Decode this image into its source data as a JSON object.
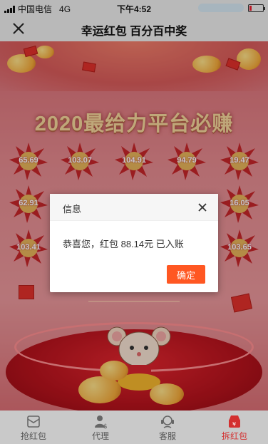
{
  "status_bar": {
    "carrier": "中国电信",
    "network": "4G",
    "time": "下午4:52"
  },
  "title_bar": {
    "title": "幸运红包 百分百中奖"
  },
  "banner": {
    "text": "2020最给力平台必赚"
  },
  "bursts": [
    "65.69",
    "103.07",
    "104.91",
    "94.79",
    "19.47",
    "62.91",
    "16.05",
    "103.41",
    "103.65"
  ],
  "dialog": {
    "title": "信息",
    "message": "恭喜您，红包 88.14元 已入账",
    "ok_label": "确定"
  },
  "tabs": [
    {
      "label": "抢红包",
      "icon": "grab-envelope-icon",
      "active": false
    },
    {
      "label": "代理",
      "icon": "agent-icon",
      "active": false
    },
    {
      "label": "客服",
      "icon": "customer-service-icon",
      "active": false
    },
    {
      "label": "拆红包",
      "icon": "open-envelope-icon",
      "active": true
    }
  ],
  "colors": {
    "accent": "#ff5722",
    "tab_active": "#d32f2f"
  }
}
